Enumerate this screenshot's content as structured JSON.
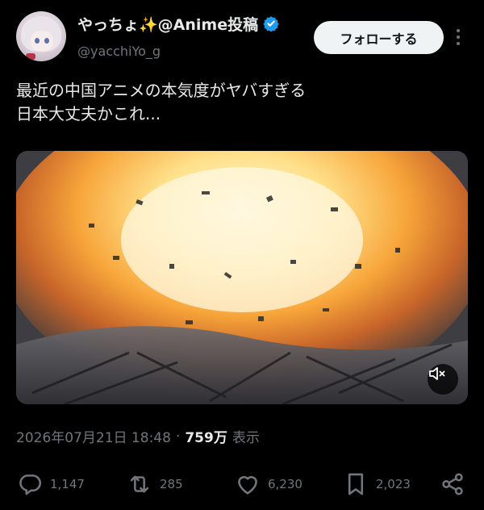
{
  "user": {
    "display_name": "やっちょ✨@Anime投稿",
    "handle": "@yacchiYo_g",
    "verified": true,
    "follow_label": "フォローする"
  },
  "tweet": {
    "text": "最近の中国アニメの本気度がヤバすぎる\n日本大丈夫かこれ..."
  },
  "meta": {
    "timestamp": "2026年07月21日 18:48",
    "separator": "·",
    "views": "759万",
    "views_label": "表示"
  },
  "actions": {
    "replies": "1,147",
    "retweets": "285",
    "likes": "6,230",
    "bookmarks": "2,023"
  },
  "colors": {
    "background": "#000000",
    "text": "#e7e9ea",
    "muted": "#71767b",
    "verified_blue": "#1d9bf0"
  },
  "icons": [
    "more-icon",
    "verified-icon",
    "mute-icon",
    "reply-icon",
    "retweet-icon",
    "like-icon",
    "bookmark-icon",
    "share-icon"
  ]
}
